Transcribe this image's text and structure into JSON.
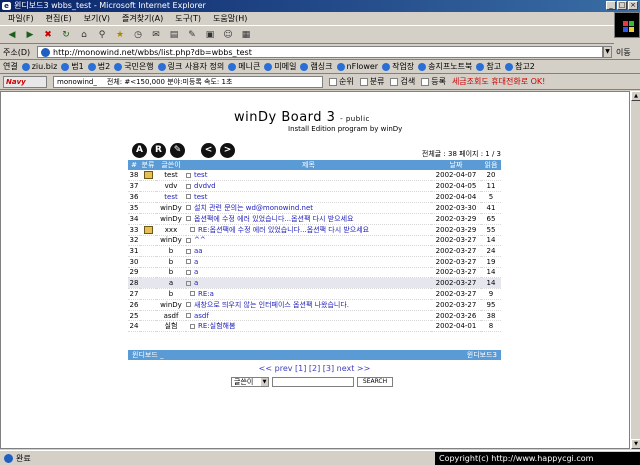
{
  "window": {
    "title": "윈디보드3 wbbs_test - Microsoft Internet Explorer"
  },
  "menu": [
    "파일(F)",
    "편집(E)",
    "보기(V)",
    "즐겨찾기(A)",
    "도구(T)",
    "도움말(H)"
  ],
  "address": {
    "label": "주소(D)",
    "url": "http://monowind.net/wbbs/list.php?db=wbbs_test",
    "go": "이동"
  },
  "links": {
    "label": "연결",
    "items": [
      "ziu.biz",
      "법1",
      "법2",
      "국민은행",
      "링크 사용자 정의",
      "메니큰",
      "미메일",
      "램싱크",
      "nFlower",
      "작업장",
      "송지프노트북",
      "참고",
      "참고2"
    ]
  },
  "navy": {
    "logo": "Navy",
    "query": "monowind_",
    "info": "전체: #<150,000  분야:미등록    속도: 1초",
    "buttons": [
      "순위",
      "분류",
      "검색",
      "등록"
    ],
    "ad": "세금조회도 휴대전화로 OK!"
  },
  "board": {
    "title": "winDy Board 3",
    "title_suffix": "- public",
    "subtitle": "Install Edition program by winDy",
    "count": "전체글 : 38 페이지 : 1 / 3",
    "headers": [
      "#",
      "분류",
      "글쓴이",
      "제목",
      "날짜",
      "읽음"
    ],
    "rows": [
      {
        "num": "38",
        "icon": true,
        "writer": "test",
        "writer_link": false,
        "subject": "test",
        "reply": false,
        "date": "2002-04-07",
        "reads": "20"
      },
      {
        "num": "37",
        "icon": false,
        "writer": "vdv",
        "writer_link": false,
        "subject": "dvdvd",
        "reply": false,
        "date": "2002-04-05",
        "reads": "11"
      },
      {
        "num": "36",
        "icon": false,
        "writer": "test",
        "writer_link": true,
        "subject": "test",
        "reply": false,
        "date": "2002-04-04",
        "reads": "5"
      },
      {
        "num": "35",
        "icon": false,
        "writer": "winDy",
        "writer_link": false,
        "subject": "설치 관련 문의는 wd@monowind.net",
        "reply": false,
        "date": "2002-03-30",
        "reads": "41"
      },
      {
        "num": "34",
        "icon": false,
        "writer": "winDy",
        "writer_link": false,
        "subject": "옵션팩에 수정 에러 있었습니다...옵션팩 다시 받으세요",
        "reply": false,
        "date": "2002-03-29",
        "reads": "65"
      },
      {
        "num": "33",
        "icon": true,
        "writer": "xxx",
        "writer_link": false,
        "subject": "RE:옵션팩에 수정 에러 있었습니다...옵션팩 다시 받으세요",
        "reply": true,
        "date": "2002-03-29",
        "reads": "55"
      },
      {
        "num": "32",
        "icon": false,
        "writer": "winDy",
        "writer_link": false,
        "subject": "^^",
        "reply": false,
        "date": "2002-03-27",
        "reads": "14"
      },
      {
        "num": "31",
        "icon": false,
        "writer": "b",
        "writer_link": false,
        "subject": "aa",
        "reply": false,
        "date": "2002-03-27",
        "reads": "24"
      },
      {
        "num": "30",
        "icon": false,
        "writer": "b",
        "writer_link": false,
        "subject": "a",
        "reply": false,
        "date": "2002-03-27",
        "reads": "19"
      },
      {
        "num": "29",
        "icon": false,
        "writer": "b",
        "writer_link": false,
        "subject": "a",
        "reply": false,
        "date": "2002-03-27",
        "reads": "14"
      },
      {
        "num": "28",
        "icon": false,
        "writer": "a",
        "writer_link": false,
        "subject": "a",
        "reply": false,
        "date": "2002-03-27",
        "reads": "14",
        "highlight": true
      },
      {
        "num": "27",
        "icon": false,
        "writer": "b",
        "writer_link": false,
        "subject": "RE:a",
        "reply": true,
        "date": "2002-03-27",
        "reads": "9"
      },
      {
        "num": "26",
        "icon": false,
        "writer": "winDy",
        "writer_link": false,
        "subject": "새창으로 띄우지 않는 인터페이스 옵션팩 나왔습니다.",
        "reply": false,
        "date": "2002-03-27",
        "reads": "95"
      },
      {
        "num": "25",
        "icon": false,
        "writer": "asdf",
        "writer_link": false,
        "subject": "asdf",
        "reply": false,
        "date": "2002-03-26",
        "reads": "38"
      },
      {
        "num": "24",
        "icon": false,
        "writer": "실험",
        "writer_link": false,
        "subject": "RE:실험해봄",
        "reply": true,
        "date": "2002-04-01",
        "reads": "8"
      }
    ],
    "footer_left": "윈디보드 _",
    "footer_right": "윈디보드3",
    "pager": "<< prev [1] [2] [3] next >>",
    "search": {
      "field": "글쓴이",
      "button": "SEARCH"
    }
  },
  "status": {
    "text": "완료",
    "copyright": "Copyright(c) http://www.happycgi.com"
  }
}
